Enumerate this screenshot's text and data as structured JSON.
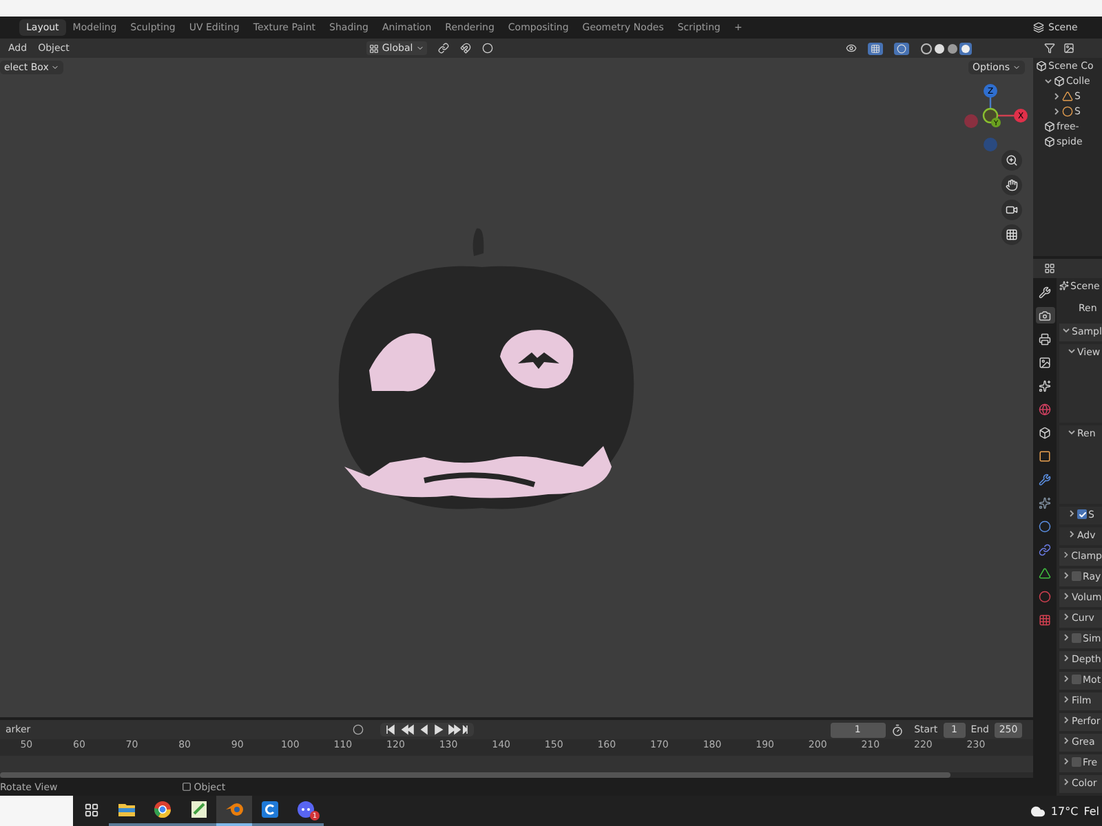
{
  "workspace_tabs": [
    {
      "label": "Layout",
      "selected": true
    },
    {
      "label": "Modeling",
      "selected": false
    },
    {
      "label": "Sculpting",
      "selected": false
    },
    {
      "label": "UV Editing",
      "selected": false
    },
    {
      "label": "Texture Paint",
      "selected": false
    },
    {
      "label": "Shading",
      "selected": false
    },
    {
      "label": "Animation",
      "selected": false
    },
    {
      "label": "Rendering",
      "selected": false
    },
    {
      "label": "Compositing",
      "selected": false
    },
    {
      "label": "Geometry Nodes",
      "selected": false
    },
    {
      "label": "Scripting",
      "selected": false
    }
  ],
  "add_workspace": "+",
  "scene_selector": {
    "label": "Scene"
  },
  "viewport_header": {
    "menus": [
      "Add",
      "Object"
    ],
    "orientation": "Global"
  },
  "viewport": {
    "select_mode": "elect Box",
    "options": "Options",
    "gizmo_axes": [
      "Z",
      "Y",
      "X"
    ]
  },
  "outliner": {
    "items": [
      {
        "label": "Scene Co",
        "kind": "collection",
        "children": [
          {
            "label": "Colle",
            "kind": "collection",
            "expanded": true,
            "children": [
              {
                "label": "S",
                "kind": "mesh",
                "expanded": false
              },
              {
                "label": "S",
                "kind": "light",
                "expanded": false
              }
            ]
          },
          {
            "label": "free-",
            "kind": "collection"
          },
          {
            "label": "spide",
            "kind": "collection"
          }
        ]
      }
    ]
  },
  "properties": {
    "title": "Scene",
    "engine_label": "Ren",
    "tabs": [
      {
        "selected": false
      },
      {
        "selected": true
      },
      {
        "selected": false
      },
      {
        "selected": false
      },
      {
        "selected": false
      },
      {
        "selected": false
      },
      {
        "selected": false
      },
      {
        "selected": false
      },
      {
        "selected": false
      },
      {
        "selected": false
      },
      {
        "selected": false
      },
      {
        "selected": false
      },
      {
        "selected": false
      },
      {
        "selected": false
      },
      {
        "selected": false
      }
    ],
    "panels": [
      {
        "label": "Sampl",
        "kind": "panel",
        "expanded": true
      },
      {
        "label": "View",
        "kind": "subpanel",
        "expanded": true
      },
      {
        "label": "Ren",
        "kind": "subpanel",
        "expanded": true
      },
      {
        "label": "S",
        "kind": "subcheck",
        "expanded": false,
        "checked": true
      },
      {
        "label": "Adv",
        "kind": "subpanel",
        "expanded": false
      },
      {
        "label": "Clamp",
        "kind": "panel",
        "expanded": false
      },
      {
        "label": "Ray",
        "kind": "check",
        "expanded": false,
        "checked": false
      },
      {
        "label": "Volum",
        "kind": "panel",
        "expanded": false
      },
      {
        "label": "Curv",
        "kind": "panel",
        "expanded": false
      },
      {
        "label": "Sim",
        "kind": "check",
        "expanded": false,
        "checked": false
      },
      {
        "label": "Depth",
        "kind": "panel",
        "expanded": false
      },
      {
        "label": "Mot",
        "kind": "check",
        "expanded": false,
        "checked": false
      },
      {
        "label": "Film",
        "kind": "panel",
        "expanded": false
      },
      {
        "label": "Perfor",
        "kind": "panel",
        "expanded": false
      },
      {
        "label": "Grea",
        "kind": "panel",
        "expanded": false
      },
      {
        "label": "Fre",
        "kind": "check",
        "expanded": false,
        "checked": false
      },
      {
        "label": "Color",
        "kind": "panel",
        "expanded": false
      }
    ]
  },
  "timeline": {
    "marker_menu": "arker",
    "current_frame": "1",
    "start_label": "Start",
    "start": "1",
    "end_label": "End",
    "end": "250",
    "ruler": [
      "50",
      "60",
      "70",
      "80",
      "90",
      "100",
      "110",
      "120",
      "130",
      "140",
      "150",
      "160",
      "170",
      "180",
      "190",
      "200",
      "210",
      "220",
      "230"
    ]
  },
  "status_bar": {
    "left": "Rotate View",
    "middle": "Object"
  },
  "taskbar": {
    "apps": [
      {
        "kind": "folder",
        "selected": false
      },
      {
        "kind": "browser",
        "selected": false
      },
      {
        "kind": "editor",
        "selected": false
      },
      {
        "kind": "blender",
        "selected": true
      },
      {
        "kind": "c-app",
        "selected": false
      },
      {
        "kind": "chat",
        "selected": false,
        "badge": "1"
      }
    ],
    "temperature": "17°C",
    "weather_text": "Fel"
  }
}
